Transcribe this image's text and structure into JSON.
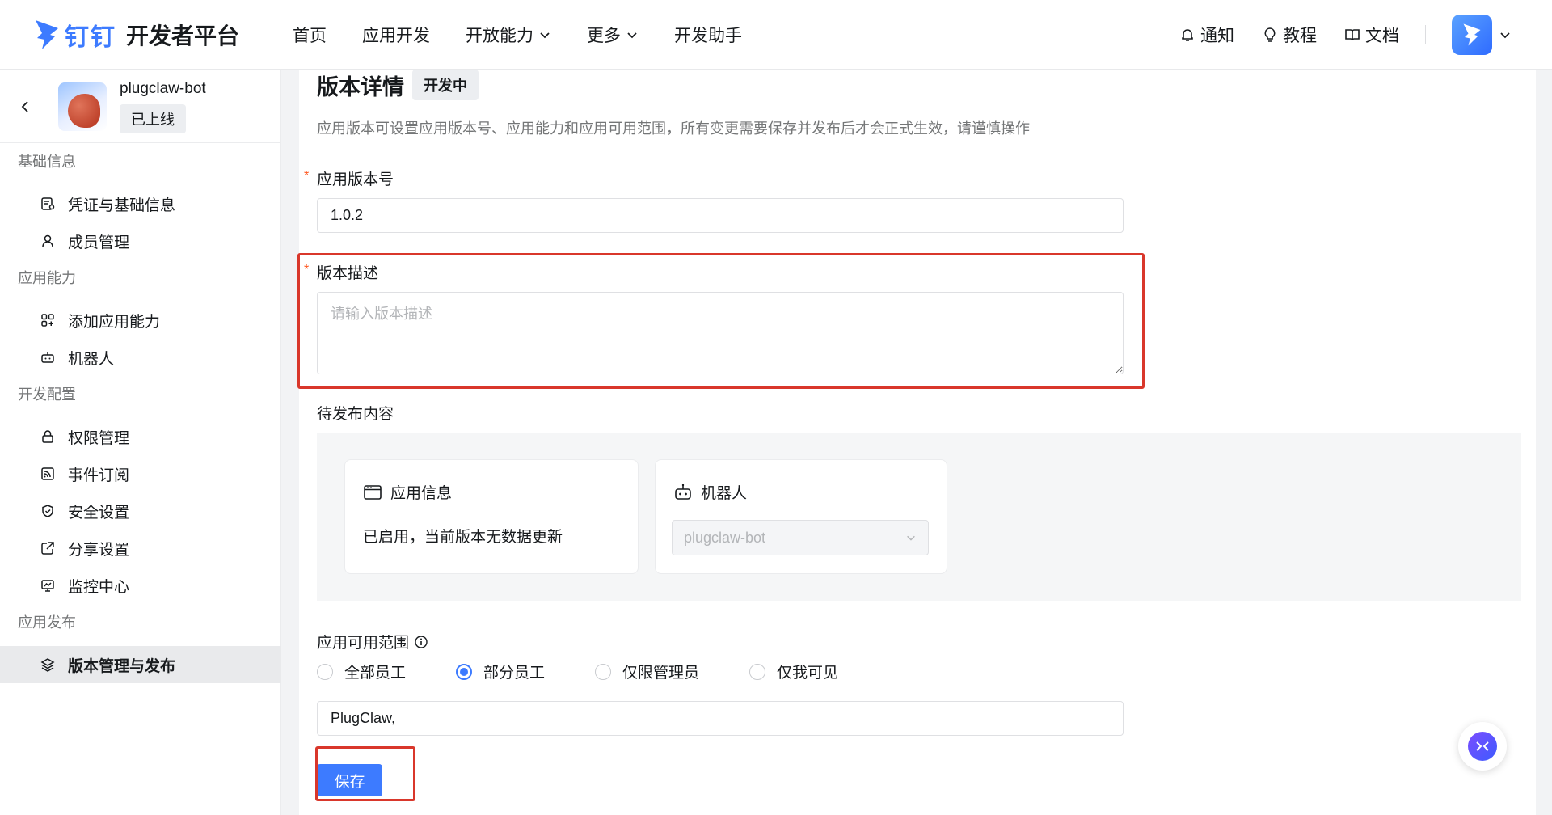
{
  "header": {
    "logo_brand": "钉钉",
    "logo_title": "开发者平台",
    "nav": [
      {
        "label": "首页",
        "dropdown": false
      },
      {
        "label": "应用开发",
        "dropdown": false
      },
      {
        "label": "开放能力",
        "dropdown": true
      },
      {
        "label": "更多",
        "dropdown": true
      },
      {
        "label": "开发助手",
        "dropdown": false
      }
    ],
    "notify_label": "通知",
    "tutorial_label": "教程",
    "docs_label": "文档"
  },
  "sidebar": {
    "app_name": "plugclaw-bot",
    "app_status": "已上线",
    "groups": [
      {
        "title": "基础信息",
        "items": [
          {
            "label": "凭证与基础信息",
            "icon": "credential-icon"
          },
          {
            "label": "成员管理",
            "icon": "user-icon"
          }
        ]
      },
      {
        "title": "应用能力",
        "items": [
          {
            "label": "添加应用能力",
            "icon": "grid-plus-icon"
          },
          {
            "label": "机器人",
            "icon": "robot-icon"
          }
        ]
      },
      {
        "title": "开发配置",
        "items": [
          {
            "label": "权限管理",
            "icon": "lock-icon"
          },
          {
            "label": "事件订阅",
            "icon": "rss-icon"
          },
          {
            "label": "安全设置",
            "icon": "shield-icon"
          },
          {
            "label": "分享设置",
            "icon": "share-icon"
          },
          {
            "label": "监控中心",
            "icon": "monitor-icon"
          }
        ]
      },
      {
        "title": "应用发布",
        "items": [
          {
            "label": "版本管理与发布",
            "icon": "layers-icon",
            "active": true
          }
        ]
      }
    ]
  },
  "main": {
    "title": "版本详情",
    "title_tag": "开发中",
    "description": "应用版本可设置应用版本号、应用能力和应用可用范围，所有变更需要保存并发布后才会正式生效，请谨慎操作",
    "version_label": "应用版本号",
    "version_value": "1.0.2",
    "desc_label": "版本描述",
    "desc_placeholder": "请输入版本描述",
    "pending_label": "待发布内容",
    "card_app_info": {
      "title": "应用信息",
      "text": "已启用，当前版本无数据更新"
    },
    "card_robot": {
      "title": "机器人",
      "select_value": "plugclaw-bot"
    },
    "scope_label": "应用可用范围",
    "scope_options": [
      {
        "label": "全部员工",
        "checked": false
      },
      {
        "label": "部分员工",
        "checked": true
      },
      {
        "label": "仅限管理员",
        "checked": false
      },
      {
        "label": "仅我可见",
        "checked": false
      }
    ],
    "scope_value": "PlugClaw,",
    "save_label": "保存"
  },
  "colors": {
    "accent": "#3d7bff",
    "highlight": "#d9372b",
    "required": "#ff5219"
  }
}
